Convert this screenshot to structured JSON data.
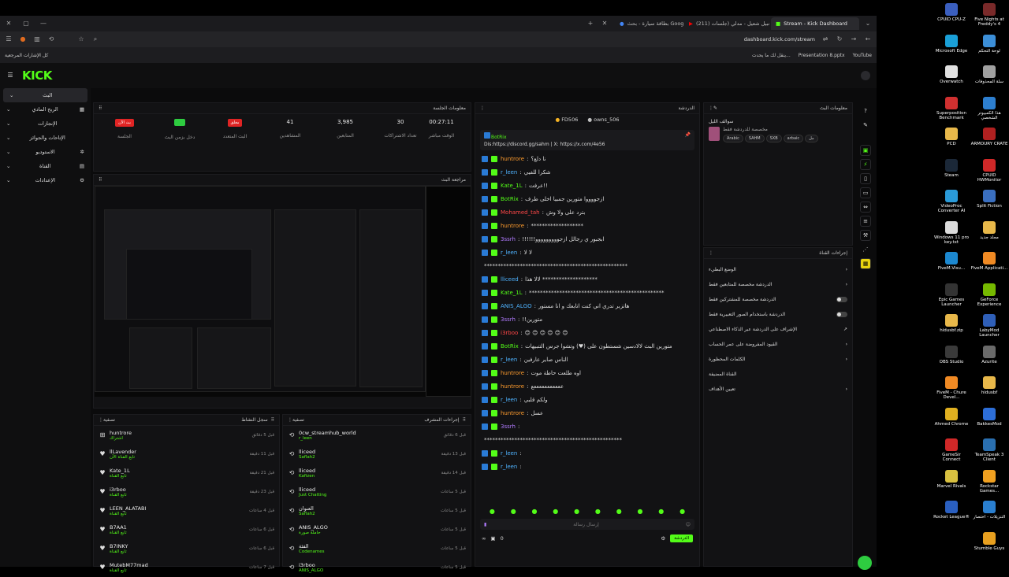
{
  "browser": {
    "tabs": [
      {
        "label": "Stream - Kick Dashboard",
        "active": true
      },
      {
        "label": "(211) نبيل شعيل - مدلي (جلسات",
        "active": false
      },
      {
        "label": "بطاقة سيارة - بحث Google",
        "active": false
      }
    ],
    "url": "dashboard.kick.com/stream",
    "bookmarks_right": [
      {
        "label": "YouTube"
      },
      {
        "label": "Presentation 8.pptx"
      },
      {
        "label": "ينقل لك ما يحدث..."
      }
    ],
    "bookmarks_left": "كل الإشارات المرجعية"
  },
  "kick": {
    "logo": "KICK",
    "sidebar": [
      {
        "label": "البث",
        "active": true
      },
      {
        "label": "الربح المادي"
      },
      {
        "label": "الإنجازات"
      },
      {
        "label": "الإتاحات والجوائز"
      },
      {
        "label": "الاستوديو"
      },
      {
        "label": "القناة"
      },
      {
        "label": "الإعدادات"
      }
    ],
    "session": {
      "title": "معلومات الجلسة",
      "badges": [
        {
          "label": "بث الآن",
          "caption": "الجلسة",
          "color": "#e02424"
        },
        {
          "label": "",
          "caption": "دخل بزمن البث",
          "color": "#2ecc40"
        },
        {
          "label": "مغلق",
          "caption": "البث المتعدد",
          "color": "#e02424"
        }
      ],
      "stats": [
        {
          "value": "41",
          "label": "المشاهدين"
        },
        {
          "value": "3,985",
          "label": "المتابعين"
        },
        {
          "value": "30",
          "label": "تعداد الاشتراكات"
        },
        {
          "value": "00:27:11",
          "label": "الوقت مباشر"
        }
      ]
    },
    "preview_title": "مراجعة البث",
    "activity": {
      "title": "سجل النشاط",
      "filter": "تصفية",
      "items": [
        {
          "name": "huntrore",
          "sub": "اشتراك",
          "time": "قبل 5 دقائق"
        },
        {
          "name": "llLavender",
          "sub": "تابع القناة الآن",
          "time": "قبل 11 دقيقة"
        },
        {
          "name": "Kate_1L",
          "sub": "تابع القناة",
          "time": "قبل 21 دقيقة"
        },
        {
          "name": "i3rboo",
          "sub": "تابع القناة",
          "time": "قبل 23 دقيقة"
        },
        {
          "name": "LEEN_ALATABI",
          "sub": "تابع القناة",
          "time": "قبل 4 ساعات"
        },
        {
          "name": "B7AA1",
          "sub": "تابع القناة",
          "time": "قبل 6 ساعات"
        },
        {
          "name": "B7INKY",
          "sub": "تابع القناة",
          "time": "قبل 6 ساعات"
        },
        {
          "name": "MutebM77mad",
          "sub": "تابع القناة",
          "time": "قبل 7 ساعات"
        }
      ]
    },
    "mod_actions": {
      "title": "إجراءات المشرف",
      "filter": "تصفية",
      "items": [
        {
          "name": "0cw_streamhub_world",
          "sub": "r_leen",
          "time": "قبل 6 دقائق"
        },
        {
          "name": "lliceed",
          "sub": "Saflah2",
          "time": "قبل 13 دقيقة"
        },
        {
          "name": "lliceed",
          "sub": "Kafizen",
          "time": "قبل 14 دقيقة"
        },
        {
          "name": "lliceed",
          "sub": "Just Chatting",
          "time": "قبل 5 ساعات"
        },
        {
          "name": "العنوان",
          "sub": "Saflah2",
          "time": "قبل 5 ساعات"
        },
        {
          "name": "ANIS_ALGO",
          "sub": "حاملة صورة",
          "time": "قبل 5 ساعات"
        },
        {
          "name": "الفئة",
          "sub": "Codenames",
          "time": "قبل 5 ساعات"
        },
        {
          "name": "i3rboo",
          "sub": "ANIS_ALGO",
          "time": "قبل 5 ساعات"
        }
      ]
    },
    "chat": {
      "title": "الدردشة",
      "top_users": [
        {
          "name": "FD506"
        },
        {
          "name": "owns_506"
        }
      ],
      "pinned_bot": "BotRix",
      "pinned_text": "Dis:https://discord.gg/sahm | X: https://x.com/4e56",
      "messages": [
        {
          "user": "huntrore",
          "color": "u-orange",
          "text": "نا دلع؟"
        },
        {
          "user": "r_leen",
          "color": "u-blue",
          "text": "شكرا للفيي"
        },
        {
          "user": "Kate_1L",
          "color": "u-green",
          "text": "عرفت!!"
        },
        {
          "user": "BotRix",
          "color": "u-green",
          "text": "ازجووووا متورين جمبيا اخلى طرف"
        },
        {
          "user": "Mohamed_tah",
          "color": "u-red",
          "text": "بترد على ولا وش"
        },
        {
          "user": "huntrore",
          "color": "u-orange",
          "text": "*******************"
        },
        {
          "user": "3ssrh",
          "color": "u-purple",
          "text": "!!!!!!ابجبور ي رجالل ازجووووووووو"
        },
        {
          "user": "r_leen",
          "color": "u-blue",
          "text": "لا لا"
        },
        {
          "user": "",
          "color": "u-orange",
          "text": "****************************************************"
        },
        {
          "user": "lliceed",
          "color": "u-blue",
          "text": "لالا هذا ********************"
        },
        {
          "user": "Kate_1L",
          "color": "u-green",
          "text": "*************************************************"
        },
        {
          "user": "ANIS_ALGO",
          "color": "u-blue",
          "text": "هاتزبر تدري اني كنت اتابعك و انا مستور"
        },
        {
          "user": "3ssrh",
          "color": "u-purple",
          "text": "!!متورين"
        },
        {
          "user": "i3rboo",
          "color": "u-red",
          "text": "😊 😊 😊 😊 😊 😊"
        },
        {
          "user": "BotRix",
          "color": "u-green",
          "text": "متورين البث لالادسين شستطون على (♥) وتشوا جرس التنبيهات"
        },
        {
          "user": "r_leen",
          "color": "u-blue",
          "text": "الناس صاير عارفين"
        },
        {
          "user": "huntrore",
          "color": "u-orange",
          "text": "اوه طلعت حاطة موت"
        },
        {
          "user": "huntrore",
          "color": "u-orange",
          "text": "عععععععععععع"
        },
        {
          "user": "r_leen",
          "color": "u-blue",
          "text": "ولكم قلبي"
        },
        {
          "user": "huntrore",
          "color": "u-orange",
          "text": "عسل"
        },
        {
          "user": "3ssrh",
          "color": "u-purple",
          "text": ""
        },
        {
          "user": "",
          "color": "u-orange",
          "text": "**************************************************"
        },
        {
          "user": "r_leen",
          "color": "u-blue",
          "text": ""
        },
        {
          "user": "r_leen",
          "color": "u-blue",
          "text": ""
        }
      ],
      "input_placeholder": "إرسال رسالة",
      "send_label": "الدردشة",
      "count": "0"
    },
    "stream_info": {
      "title": "معلومات البث",
      "channel": "سوالف الليل",
      "category": "مخصصة للدردشة فقط",
      "tags": [
        "Arabic",
        "SAHM",
        "SXB",
        "arbaic",
        "مل"
      ]
    },
    "chat_actions": {
      "title": "إجراءات القناة",
      "items": [
        {
          "label": "الوضع البطيء",
          "control": "arrow"
        },
        {
          "label": "الدردشة مخصصة للمتابعين فقط",
          "control": "arrow"
        },
        {
          "label": "الدردشة مخصصة للمشتركين فقط",
          "control": "toggle"
        },
        {
          "label": "الدردشة باستخدام الصور التعبيرية فقط",
          "control": "toggle"
        },
        {
          "label": "الإشراف على الدردشة عبر الذكاء الاصطناعي",
          "control": "ext"
        },
        {
          "label": "القيود المفروضة على عمر الحساب",
          "control": "arrow"
        },
        {
          "label": "الكلمات المحظورة",
          "control": "arrow"
        },
        {
          "label": "القناة المضيفة",
          "control": "none"
        },
        {
          "label": "تعيين الأهداف",
          "control": "arrow"
        }
      ]
    }
  },
  "desktop": {
    "icons": [
      {
        "label": "Five Nights at Freddy's 4",
        "color": "#7a2a2a"
      },
      {
        "label": "CPUID CPU-Z",
        "color": "#3b5fbf"
      },
      {
        "label": "لوحة التحكم",
        "color": "#3c8fd8"
      },
      {
        "label": "Microsoft Edge",
        "color": "#1aa0d8"
      },
      {
        "label": "سلة المحذوفات",
        "color": "#a0a0a0"
      },
      {
        "label": "Overwatch",
        "color": "#e0e0e0"
      },
      {
        "label": "هذا الكمبيوتر الشخصي",
        "color": "#2d7fd0"
      },
      {
        "label": "Superposition Benchmark",
        "color": "#d03030"
      },
      {
        "label": "ARMOURY CRATE",
        "color": "#b02020"
      },
      {
        "label": "PCD",
        "color": "#e8b84a"
      },
      {
        "label": "CPUID HWMonitor",
        "color": "#d02828"
      },
      {
        "label": "Steam",
        "color": "#1b2838"
      },
      {
        "label": "Split Fiction",
        "color": "#3a6fc0"
      },
      {
        "label": "VideoProc Converter AI",
        "color": "#2a9ad8"
      },
      {
        "label": "مجلد جديد",
        "color": "#e8b84a"
      },
      {
        "label": "Windows 11 pro key.txt",
        "color": "#dcdcdc"
      },
      {
        "label": "FiveM Applicati...",
        "color": "#f08a24"
      },
      {
        "label": "FiveM.Visu...",
        "color": "#1c88d0"
      },
      {
        "label": "GeForce Experience",
        "color": "#76b900"
      },
      {
        "label": "Epic Games Launcher",
        "color": "#333333"
      },
      {
        "label": "LabyMod Launcher",
        "color": "#2f5fb8"
      },
      {
        "label": "hidusbf.zip",
        "color": "#e8b84a"
      },
      {
        "label": "Azurite",
        "color": "#6a6a6a"
      },
      {
        "label": "OBS Studio",
        "color": "#3a3a3a"
      },
      {
        "label": "hidusbf",
        "color": "#e8b84a"
      },
      {
        "label": "FiveM - Chure Devel...",
        "color": "#f08a24"
      },
      {
        "label": "BakkesMod",
        "color": "#2d6ed8"
      },
      {
        "label": "Ahmed Chrome",
        "color": "#e0b020"
      },
      {
        "label": "TeamSpeak 3 Client",
        "color": "#2a6fb0"
      },
      {
        "label": "GameSir Connect",
        "color": "#d02828"
      },
      {
        "label": "Rockstar Games...",
        "color": "#f0a020"
      },
      {
        "label": "Marvel Rivals",
        "color": "#d8c040"
      },
      {
        "label": "التنزيلات - اختصار",
        "color": "#2a7fd0"
      },
      {
        "label": "Rocket League®",
        "color": "#2a5fc0"
      },
      {
        "label": "Stumble Guys",
        "color": "#e8a020"
      }
    ]
  }
}
